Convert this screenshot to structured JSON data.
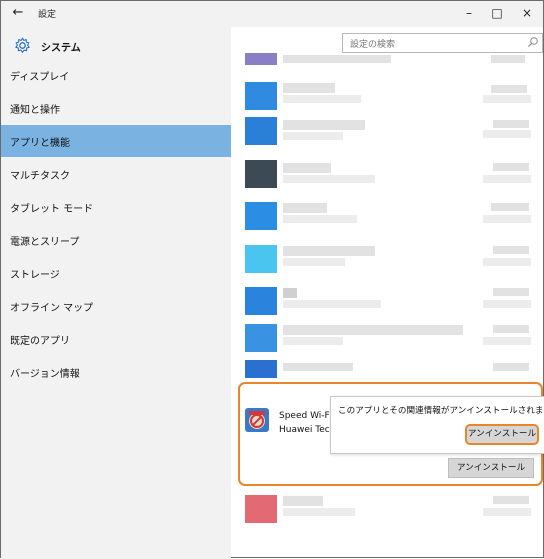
{
  "window": {
    "title": "設定",
    "back_glyph": "←",
    "minimize_glyph": "–",
    "maximize_glyph": "□",
    "close_glyph": "×"
  },
  "sidebar": {
    "header": "システム",
    "items": [
      {
        "label": "ディスプレイ",
        "active": false
      },
      {
        "label": "通知と操作",
        "active": false
      },
      {
        "label": "アプリと機能",
        "active": true
      },
      {
        "label": "マルチタスク",
        "active": false
      },
      {
        "label": "タブレット モード",
        "active": false
      },
      {
        "label": "電源とスリープ",
        "active": false
      },
      {
        "label": "ストレージ",
        "active": false
      },
      {
        "label": "オフライン マップ",
        "active": false
      },
      {
        "label": "既定のアプリ",
        "active": false
      },
      {
        "label": "バージョン情報",
        "active": false
      }
    ]
  },
  "search": {
    "placeholder": "設定の検索"
  },
  "selected_app": {
    "name": "Speed Wi-F",
    "company": "Huawei Tec",
    "uninstall_label": "アンインストール"
  },
  "confirm_popup": {
    "message": "このアプリとその関連情報がアンインストールされます。",
    "confirm_label": "アンインストール"
  },
  "colors": {
    "accent": "#7ab3e1",
    "highlight_outline": "#e8862a",
    "sidebar_bg": "#f2f2f2"
  },
  "icons": [
    "back-arrow-icon",
    "gear-icon",
    "search-icon",
    "app-logo-icon"
  ]
}
